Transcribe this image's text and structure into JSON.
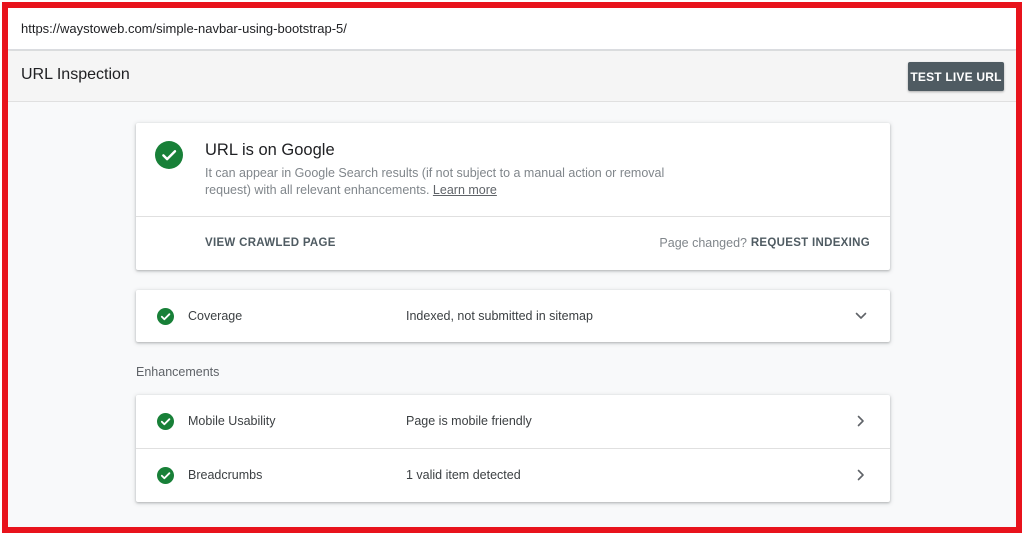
{
  "url_bar": {
    "url": "https://waystoweb.com/simple-navbar-using-bootstrap-5/"
  },
  "header": {
    "title": "URL Inspection",
    "test_live_url_label": "TEST LIVE URL"
  },
  "status_card": {
    "icon": "check-circle-icon",
    "title": "URL is on Google",
    "description": "It can appear in Google Search results (if not subject to a manual action or removal request) with all relevant enhancements.",
    "learn_more": "Learn more",
    "view_crawled_label": "VIEW CRAWLED PAGE",
    "page_changed_text": "Page changed?",
    "request_indexing_label": "REQUEST INDEXING"
  },
  "coverage": {
    "label": "Coverage",
    "value": "Indexed, not submitted in sitemap",
    "icon": "chevron-down-icon"
  },
  "enhancements": {
    "section_label": "Enhancements",
    "items": [
      {
        "label": "Mobile Usability",
        "value": "Page is mobile friendly",
        "icon": "chevron-right-icon"
      },
      {
        "label": "Breadcrumbs",
        "value": "1 valid item detected",
        "icon": "chevron-right-icon"
      }
    ]
  },
  "colors": {
    "success": "#188038",
    "button_bg": "#4f5b62",
    "frame_border": "#e8131c"
  }
}
